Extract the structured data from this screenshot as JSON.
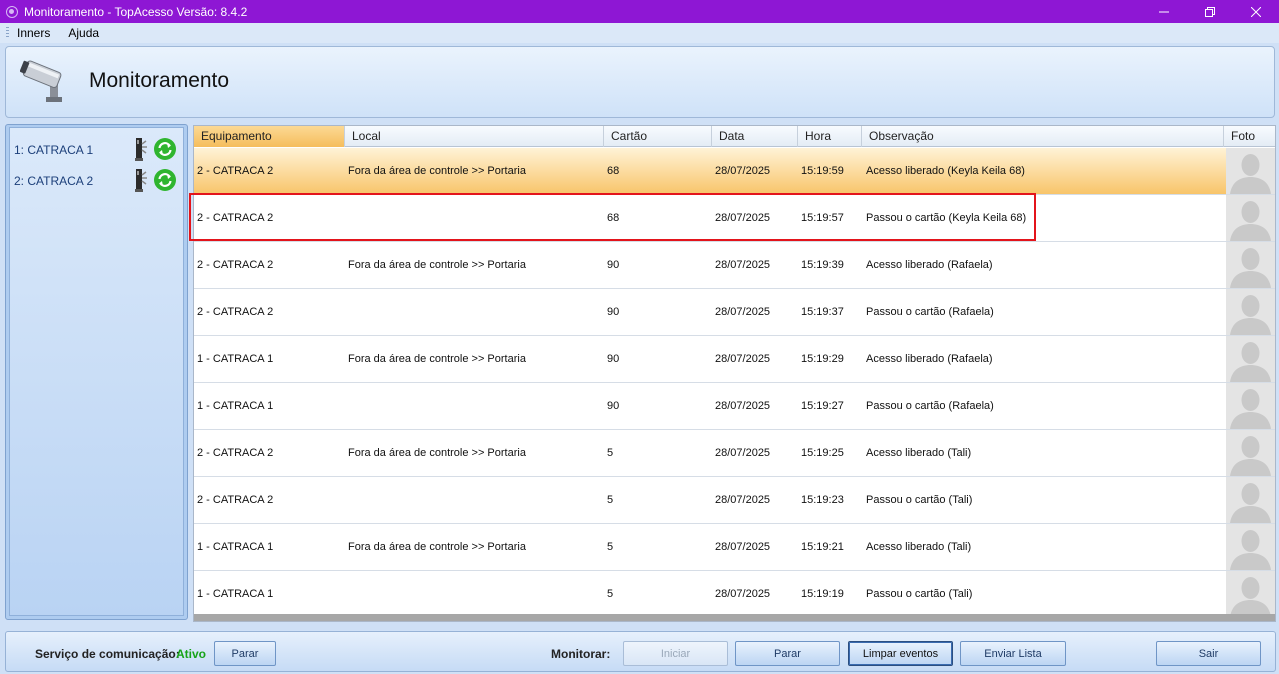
{
  "window": {
    "title": "Monitoramento - TopAcesso Versão: 8.4.2",
    "controls": [
      "minimize",
      "restore",
      "close"
    ]
  },
  "menu": {
    "items": [
      "Inners",
      "Ajuda"
    ]
  },
  "header": {
    "title": "Monitoramento",
    "icon": "security-camera-icon"
  },
  "devices": [
    {
      "label": "1: CATRACA 1",
      "icons": [
        "turnstile-icon",
        "refresh-icon"
      ]
    },
    {
      "label": "2: CATRACA 2",
      "icons": [
        "turnstile-icon",
        "refresh-icon"
      ]
    }
  ],
  "grid": {
    "columns": [
      "Equipamento",
      "Local",
      "Cartão",
      "Data",
      "Hora",
      "Observação",
      "Foto"
    ],
    "selected_row": 0,
    "highlighted_row": 1,
    "rows": [
      {
        "equipamento": "2 - CATRACA 2",
        "local": "Fora da área de controle >> Portaria",
        "cartao": "68",
        "data": "28/07/2025",
        "hora": "15:19:59",
        "observacao": "Acesso liberado (Keyla Keila 68)"
      },
      {
        "equipamento": "2 - CATRACA 2",
        "local": "",
        "cartao": "68",
        "data": "28/07/2025",
        "hora": "15:19:57",
        "observacao": "Passou o cartão (Keyla Keila 68)"
      },
      {
        "equipamento": "2 - CATRACA 2",
        "local": "Fora da área de controle >> Portaria",
        "cartao": "90",
        "data": "28/07/2025",
        "hora": "15:19:39",
        "observacao": "Acesso liberado (Rafaela)"
      },
      {
        "equipamento": "2 - CATRACA 2",
        "local": "",
        "cartao": "90",
        "data": "28/07/2025",
        "hora": "15:19:37",
        "observacao": "Passou o cartão (Rafaela)"
      },
      {
        "equipamento": "1 - CATRACA 1",
        "local": "Fora da área de controle >> Portaria",
        "cartao": "90",
        "data": "28/07/2025",
        "hora": "15:19:29",
        "observacao": "Acesso liberado (Rafaela)"
      },
      {
        "equipamento": "1 - CATRACA 1",
        "local": "",
        "cartao": "90",
        "data": "28/07/2025",
        "hora": "15:19:27",
        "observacao": "Passou o cartão (Rafaela)"
      },
      {
        "equipamento": "2 - CATRACA 2",
        "local": "Fora da área de controle >> Portaria",
        "cartao": "5",
        "data": "28/07/2025",
        "hora": "15:19:25",
        "observacao": "Acesso liberado (Tali)"
      },
      {
        "equipamento": "2 - CATRACA 2",
        "local": "",
        "cartao": "5",
        "data": "28/07/2025",
        "hora": "15:19:23",
        "observacao": "Passou o cartão (Tali)"
      },
      {
        "equipamento": "1 - CATRACA 1",
        "local": "Fora da área de controle >> Portaria",
        "cartao": "5",
        "data": "28/07/2025",
        "hora": "15:19:21",
        "observacao": "Acesso liberado (Tali)"
      },
      {
        "equipamento": "1 - CATRACA 1",
        "local": "",
        "cartao": "5",
        "data": "28/07/2025",
        "hora": "15:19:19",
        "observacao": "Passou o cartão (Tali)"
      }
    ]
  },
  "footer": {
    "service_label": "Serviço de comunicação:",
    "service_status": "Ativo",
    "service_stop_label": "Parar",
    "monitor_label": "Monitorar:",
    "start_label": "Iniciar",
    "stop_label": "Parar",
    "clear_label": "Limpar eventos",
    "send_label": "Enviar Lista",
    "exit_label": "Sair"
  },
  "colors": {
    "titlebar": "#8e17d4",
    "selected_row": "#f8c56a",
    "highlight_border": "#e3141b",
    "status_active": "#17a317",
    "refresh_green": "#2fb52f"
  }
}
